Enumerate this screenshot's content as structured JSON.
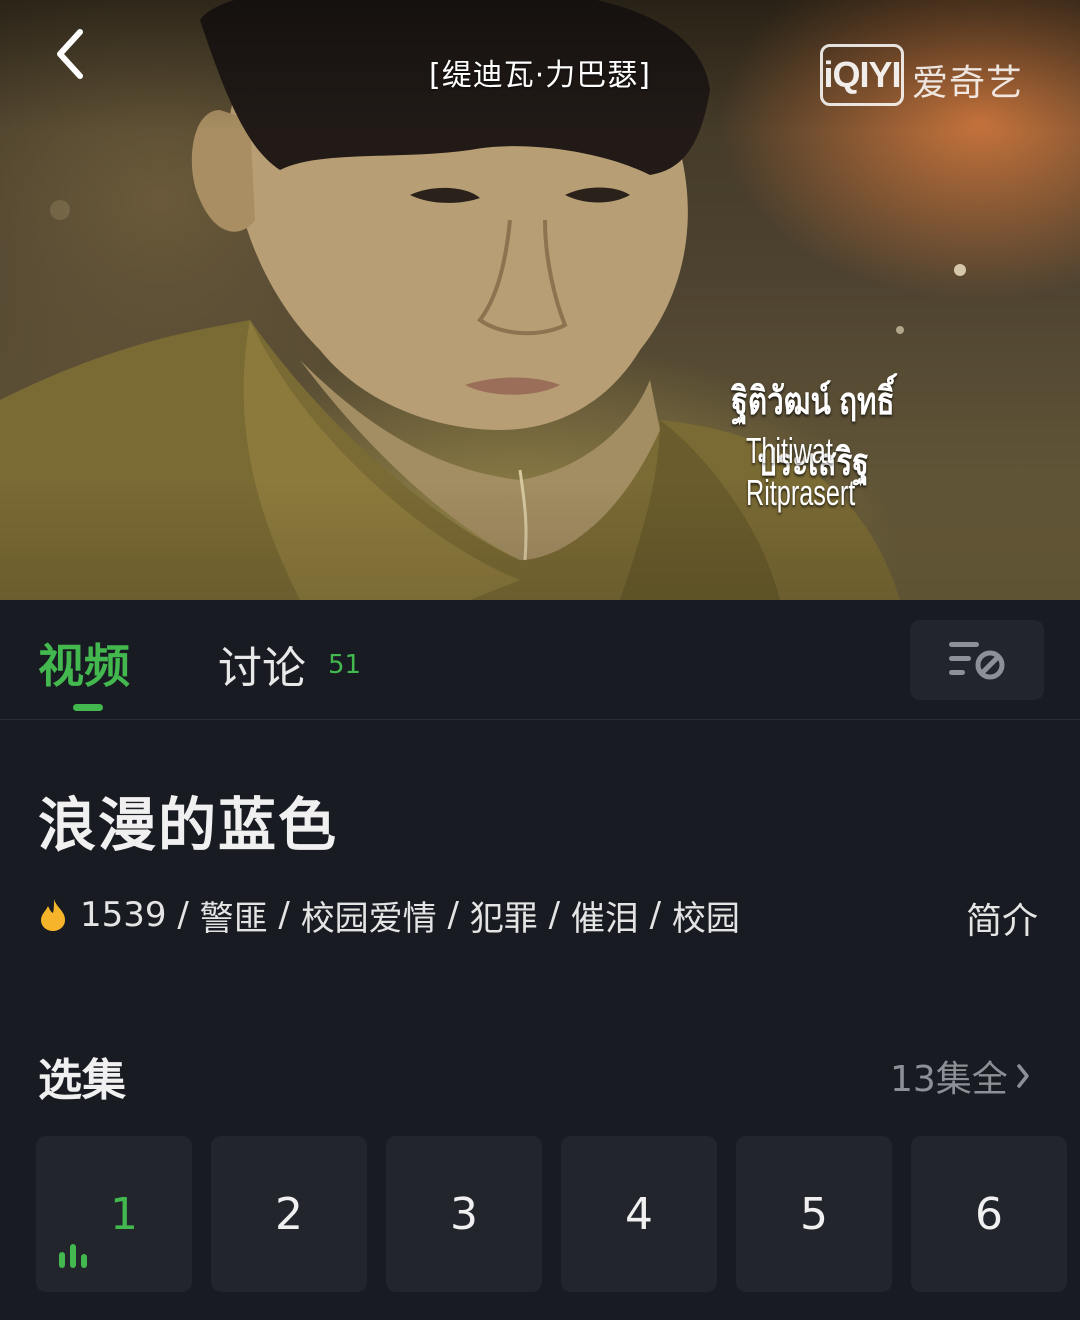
{
  "player": {
    "title": "[缇迪瓦·力巴瑟]",
    "logo_mark": "iQIYI",
    "logo_text": "爱奇艺",
    "caption_thai": "ฐิติวัฒน์ ฤทธิ์ประเสริฐ",
    "caption_en": "Thitiwat Ritprasert",
    "back_icon": "chevron-left-icon"
  },
  "tabs": {
    "video_label": "视频",
    "discuss_label": "讨论",
    "discuss_count": "51",
    "filter_icon": "filter-off-icon"
  },
  "show": {
    "title": "浪漫的蓝色",
    "heat": "1539",
    "heat_icon": "fire-icon",
    "tags": [
      "警匪",
      "校园爱情",
      "犯罪",
      "催泪",
      "校园"
    ],
    "separator": " / ",
    "intro_label": "简介"
  },
  "episodes": {
    "heading": "选集",
    "total_label": "13集全",
    "items": [
      "1",
      "2",
      "3",
      "4",
      "5",
      "6"
    ],
    "current": "1"
  },
  "colors": {
    "accent": "#42b84e",
    "background": "#181b21",
    "tile": "#22262c",
    "muted_text": "#8d9096",
    "heat": "#f5b42a"
  }
}
